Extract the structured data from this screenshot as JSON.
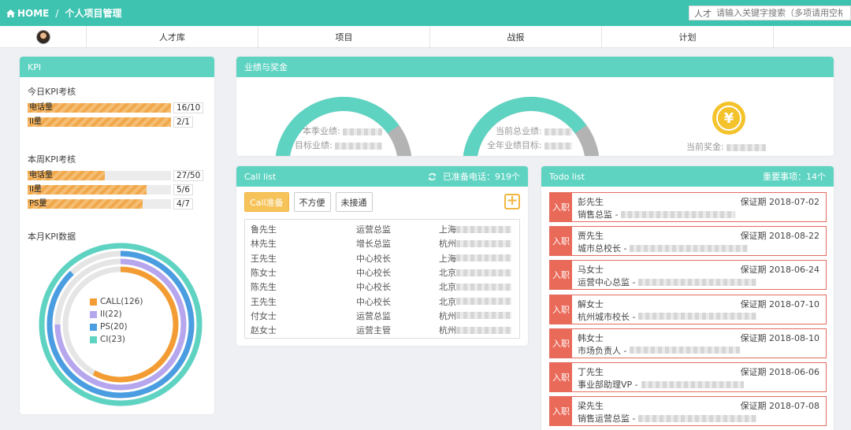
{
  "breadcrumb": {
    "home": "HOME",
    "sep": "/",
    "current": "个人项目管理"
  },
  "search": {
    "scope": "人才",
    "placeholder": "请输入关键字搜索（多项请用空格隔开）"
  },
  "nav": {
    "items": [
      "人才库",
      "项目",
      "战报",
      "计划"
    ]
  },
  "kpi": {
    "title": "KPI",
    "today": {
      "title": "今日KPI考核",
      "bars": [
        {
          "label": "电话量",
          "value": "16/10",
          "ratio": 1.0
        },
        {
          "label": "II量",
          "value": "2/1",
          "ratio": 1.0
        }
      ]
    },
    "week": {
      "title": "本周KPI考核",
      "bars": [
        {
          "label": "电话量",
          "value": "27/50",
          "ratio": 0.54
        },
        {
          "label": "II量",
          "value": "5/6",
          "ratio": 0.83
        },
        {
          "label": "PS量",
          "value": "4/7",
          "ratio": 0.8
        }
      ]
    },
    "month_title": "本月KPI数据",
    "legend": [
      {
        "label": "CALL(126)",
        "color": "#f39c33"
      },
      {
        "label": "II(22)",
        "color": "#b6a6ee"
      },
      {
        "label": "PS(20)",
        "color": "#4a9de0"
      },
      {
        "label": "CI(23)",
        "color": "#5fd3c2"
      }
    ]
  },
  "chart_data": {
    "type": "radial-bar",
    "series": [
      {
        "name": "CALL",
        "value": 126,
        "fraction": 0.58
      },
      {
        "name": "II",
        "value": 22,
        "fraction": 0.75
      },
      {
        "name": "PS",
        "value": 20,
        "fraction": 0.88
      },
      {
        "name": "CI",
        "value": 23,
        "fraction": 1.0
      }
    ],
    "colors": [
      "#f39c33",
      "#b6a6ee",
      "#4a9de0",
      "#5fd3c2"
    ],
    "track_color": "#e5e5e5"
  },
  "perf": {
    "title": "业绩与奖金",
    "gauge1": {
      "l1": "本季业绩:",
      "l2": "目标业绩:",
      "fraction": 0.8
    },
    "gauge2": {
      "l1": "当前总业绩:",
      "l2": "全年业绩目标:",
      "fraction": 0.8
    },
    "bonus_label": "当前奖金:",
    "coin_symbol": "¥"
  },
  "calllist": {
    "title": "Call list",
    "ready_label": "已准备电话：919个",
    "buttons": [
      "Call准备",
      "不方便",
      "未接通"
    ],
    "rows": [
      {
        "name": "鲁先生",
        "title": "运营总监",
        "city": "上海"
      },
      {
        "name": "林先生",
        "title": "增长总监",
        "city": "杭州"
      },
      {
        "name": "王先生",
        "title": "中心校长",
        "city": "上海"
      },
      {
        "name": "陈女士",
        "title": "中心校长",
        "city": "北京"
      },
      {
        "name": "陈先生",
        "title": "中心校长",
        "city": "北京"
      },
      {
        "name": "王先生",
        "title": "中心校长",
        "city": "北京"
      },
      {
        "name": "付女士",
        "title": "运营总监",
        "city": "杭州"
      },
      {
        "name": "赵女士",
        "title": "运营主管",
        "city": "杭州"
      }
    ]
  },
  "todo": {
    "title": "Todo list",
    "important": "重要事项：14个",
    "items": [
      {
        "tag": "入职",
        "name": "彭先生",
        "period": "保证期 2018-07-02",
        "role": "销售总监 -"
      },
      {
        "tag": "入职",
        "name": "贾先生",
        "period": "保证期 2018-08-22",
        "role": "城市总校长 -"
      },
      {
        "tag": "入职",
        "name": "马女士",
        "period": "保证期 2018-06-24",
        "role": "运营中心总监 -"
      },
      {
        "tag": "入职",
        "name": "解女士",
        "period": "保证期 2018-07-10",
        "role": "杭州城市校长 -"
      },
      {
        "tag": "入职",
        "name": "韩女士",
        "period": "保证期 2018-08-10",
        "role": "市场负责人 -"
      },
      {
        "tag": "入职",
        "name": "丁先生",
        "period": "保证期 2018-06-06",
        "role": "事业部助理VP -"
      },
      {
        "tag": "入职",
        "name": "梁先生",
        "period": "保证期 2018-07-08",
        "role": "销售运营总监 -"
      }
    ]
  }
}
